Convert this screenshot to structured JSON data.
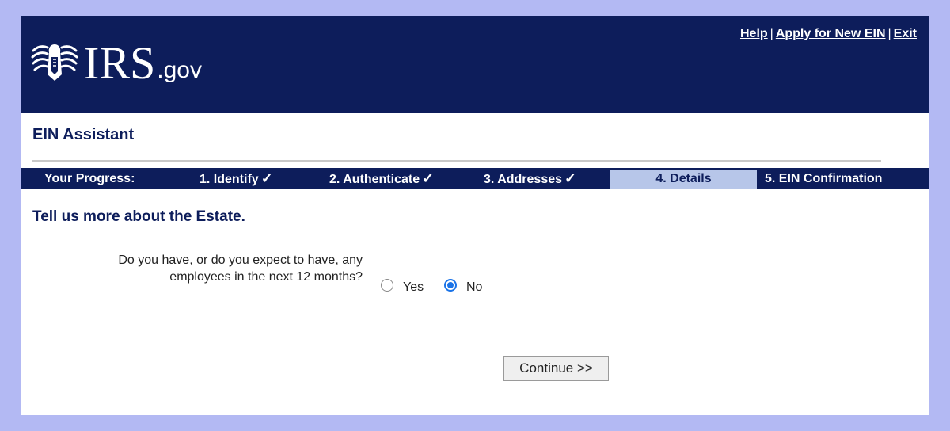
{
  "header": {
    "logo_text": "IRS",
    "logo_suffix": ".gov",
    "links": {
      "help": "Help",
      "apply": "Apply for New EIN",
      "exit": "Exit",
      "separator": "|"
    }
  },
  "app_title": "EIN Assistant",
  "progress": {
    "label": "Your Progress:",
    "steps": [
      {
        "label": "1. Identify",
        "completed": true
      },
      {
        "label": "2. Authenticate",
        "completed": true
      },
      {
        "label": "3. Addresses",
        "completed": true
      },
      {
        "label": "4. Details",
        "completed": false,
        "current": true
      },
      {
        "label": "5. EIN Confirmation",
        "completed": false
      }
    ],
    "check_glyph": "✓"
  },
  "form": {
    "heading": "Tell us more about the Estate.",
    "question_line1": "Do you have, or do you expect to have, any",
    "question_line2": "employees in the next 12 months?",
    "options": [
      {
        "label": "Yes",
        "selected": false
      },
      {
        "label": "No",
        "selected": true
      }
    ],
    "continue_label": "Continue >>"
  },
  "colors": {
    "navy": "#0d1d5b",
    "current_step_bg": "#b7c6e9",
    "page_backdrop": "#b3b9f3",
    "radio_accent": "#1a73e8"
  }
}
